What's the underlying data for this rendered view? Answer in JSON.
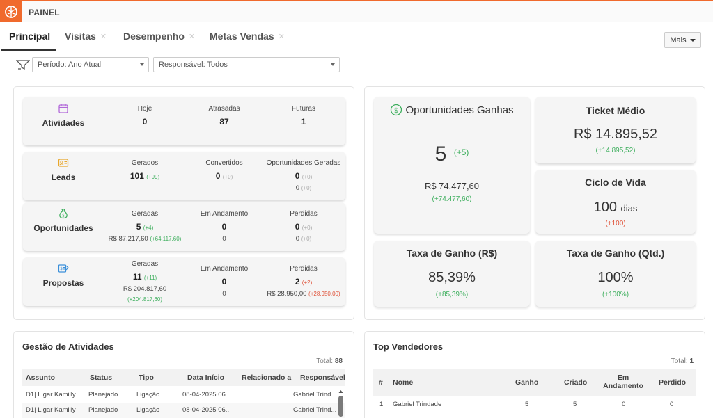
{
  "app": {
    "title": "PAINEL"
  },
  "tabs": [
    {
      "label": "Principal",
      "closable": false,
      "active": true
    },
    {
      "label": "Visitas",
      "closable": true
    },
    {
      "label": "Desempenho",
      "closable": true
    },
    {
      "label": "Metas Vendas",
      "closable": true
    }
  ],
  "more_button": "Mais",
  "filters": {
    "period": "Período: Ano Atual",
    "responsible": "Responsável: Todos"
  },
  "metrics": {
    "atividades": {
      "name": "Atividades",
      "cols": [
        {
          "label": "Hoje",
          "value": "0"
        },
        {
          "label": "Atrasadas",
          "value": "87"
        },
        {
          "label": "Futuras",
          "value": "1"
        }
      ]
    },
    "leads": {
      "name": "Leads",
      "cols": [
        {
          "label": "Gerados",
          "value": "101",
          "delta": "(+99)"
        },
        {
          "label": "Convertidos",
          "value": "0",
          "delta": "(+0)"
        },
        {
          "label": "Oportunidades Geradas",
          "value": "0",
          "delta": "(+0)",
          "sub": "0",
          "sub_delta": "(+0)"
        }
      ]
    },
    "oportunidades": {
      "name": "Oportunidades",
      "cols": [
        {
          "label": "Geradas",
          "value": "5",
          "delta": "(+4)",
          "sub": "R$ 87.217,60",
          "sub_delta": "(+64.117,60)"
        },
        {
          "label": "Em Andamento",
          "value": "0",
          "sub": "0"
        },
        {
          "label": "Perdidas",
          "value": "0",
          "delta": "(+0)",
          "sub": "0",
          "sub_delta": "(+0)"
        }
      ]
    },
    "propostas": {
      "name": "Propostas",
      "cols": [
        {
          "label": "Geradas",
          "value": "11",
          "delta": "(+11)",
          "sub": "R$ 204.817,60",
          "sub2": "(+204.817,60)"
        },
        {
          "label": "Em Andamento",
          "value": "0",
          "sub": "0"
        },
        {
          "label": "Perdidas",
          "value": "2",
          "delta": "(+2)",
          "sub": "R$ 28.950,00",
          "sub_delta": "(+28.950,00)"
        }
      ]
    }
  },
  "kpis": {
    "oportunidades_ganhas": {
      "title": "Oportunidades Ganhas",
      "value": "5",
      "delta": "(+5)",
      "amount": "R$ 74.477,60",
      "amount_delta": "(+74.477,60)"
    },
    "ticket_medio": {
      "title": "Ticket Médio",
      "value": "R$ 14.895,52",
      "delta": "(+14.895,52)"
    },
    "ciclo_vida": {
      "title": "Ciclo de Vida",
      "value": "100",
      "unit": "dias",
      "delta": "(+100)"
    },
    "taxa_ganho_rs": {
      "title": "Taxa de Ganho (R$)",
      "value": "85,39%",
      "delta": "(+85,39%)"
    },
    "taxa_ganho_qtd": {
      "title": "Taxa de Ganho (Qtd.)",
      "value": "100%",
      "delta": "(+100%)"
    }
  },
  "gestao": {
    "title": "Gestão de Atividades",
    "total_label": "Total:",
    "total": "88",
    "columns": [
      "Assunto",
      "Status",
      "Tipo",
      "Data Início",
      "Relacionado a",
      "Responsável"
    ],
    "rows": [
      [
        "D1| Ligar Kamilly",
        "Planejado",
        "Ligação",
        "08-04-2025 06...",
        "",
        "Gabriel Trind..."
      ],
      [
        "D1| Ligar Kamilly",
        "Planejado",
        "Ligação",
        "08-04-2025 06...",
        "",
        "Gabriel Trind..."
      ]
    ]
  },
  "top": {
    "title": "Top Vendedores",
    "total_label": "Total:",
    "total": "1",
    "columns": [
      "#",
      "Nome",
      "Ganho",
      "Criado",
      "Em Andamento",
      "Perdido"
    ],
    "rows": [
      [
        "1",
        "Gabriel Trindade",
        "5",
        "5",
        "0",
        "0"
      ]
    ]
  },
  "colors": {
    "accent": "#f06a2d",
    "positive": "#3cae5c",
    "negative": "#e0533a"
  }
}
